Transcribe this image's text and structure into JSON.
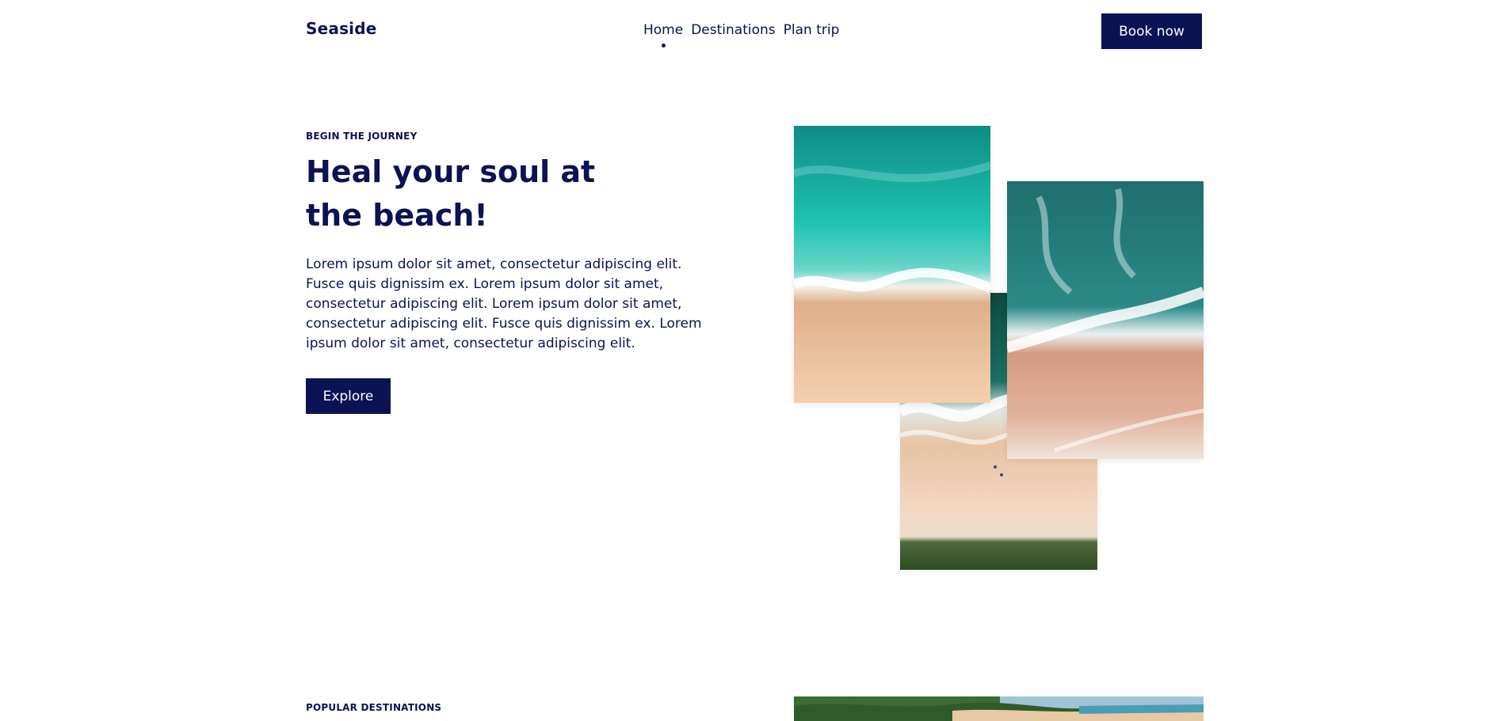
{
  "header": {
    "logo": "Seaside",
    "nav": [
      {
        "label": "Home",
        "active": true
      },
      {
        "label": "Destinations",
        "active": false
      },
      {
        "label": "Plan trip",
        "active": false
      }
    ],
    "cta_label": "Book now"
  },
  "hero": {
    "eyebrow": "BEGIN THE JOURNEY",
    "title": "Heal your soul at the beach!",
    "body": "Lorem ipsum dolor sit amet, consectetur adipiscing elit. Fusce quis dignissim ex. Lorem ipsum dolor sit amet, consectetur adipiscing elit. Lorem ipsum dolor sit amet, consectetur adipiscing elit. Fusce quis dignissim ex. Lorem ipsum dolor sit amet, consectetur adipiscing elit.",
    "button_label": "Explore"
  },
  "destinations": {
    "eyebrow": "POPULAR DESTINATIONS"
  },
  "colors": {
    "brand": "#0b1354",
    "background": "#ffffff"
  }
}
